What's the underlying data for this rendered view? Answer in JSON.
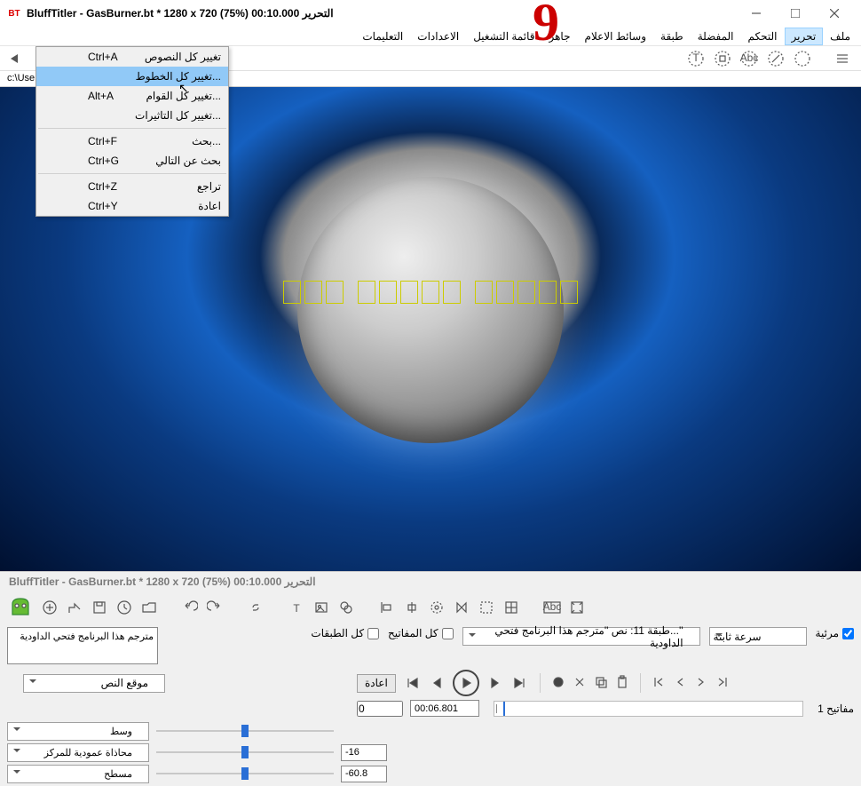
{
  "window": {
    "icon_text": "BT",
    "title": "BluffTitler - GasBurner.bt * 1280 x 720 (75%) 00:10.000 التحرير"
  },
  "big_red": "9",
  "menubar": [
    "ملف",
    "تحرير",
    "التحكم",
    "المفضلة",
    "طبقة",
    "وسائط الاعلام",
    "جاهز",
    "قائمة التشغيل",
    "الاعدادات",
    "التعليمات"
  ],
  "dropdown": {
    "items": [
      {
        "label": "تغيير كل النصوص",
        "shortcut": "Ctrl+A"
      },
      {
        "label": "...تغيير كل الخطوط",
        "shortcut": "",
        "hover": true
      },
      {
        "label": "...تغيير كل القوام",
        "shortcut": "Alt+A"
      },
      {
        "label": "...تغيير كل التاثيرات",
        "shortcut": ""
      },
      {
        "sep": true
      },
      {
        "label": "...بحث",
        "shortcut": "Ctrl+F"
      },
      {
        "label": "بحث عن التالي",
        "shortcut": "Ctrl+G"
      },
      {
        "sep": true
      },
      {
        "label": "تراجع",
        "shortcut": "Ctrl+Z"
      },
      {
        "label": "اعادة",
        "shortcut": "Ctrl+Y"
      }
    ]
  },
  "path": "c:\\Use                                                     \\Shows\\Text\\GasBurner.bt",
  "bottom": {
    "title": "BluffTitler - GasBurner.bt * 1280 x 720 (75%) 00:10.000 التحرير",
    "visible_label": "مرئية",
    "speed_select": "سرعة ثابتة",
    "layer_select": "''...طبقة   11: نص ''مترجم هذا البرنامج فتحي الداودية",
    "all_keys_label": "كل المفاتيح",
    "all_layers_label": "كل الطبقات",
    "textarea_value": "مترجم هذا البرنامج فتحي الداودية",
    "reset_btn": "اعادة",
    "prop_select": "موقع النص",
    "time_field": "00:06.801",
    "keys_label": "مفاتيح 1",
    "sliders": [
      {
        "select": "وسط",
        "value": "0",
        "thumb": 50
      },
      {
        "select": "محاذاة عمودية للمركز",
        "value": "-16",
        "thumb": 50
      },
      {
        "select": "مسطح",
        "value": "-60.8",
        "thumb": 50
      }
    ]
  }
}
